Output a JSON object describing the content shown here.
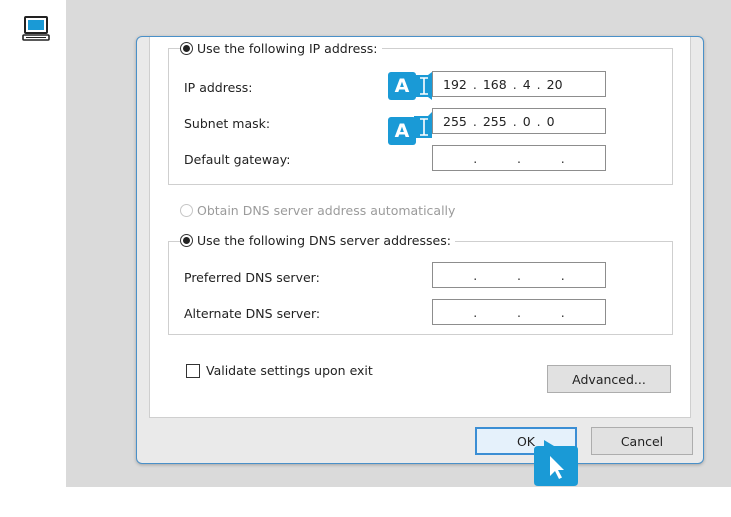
{
  "side_icon": "computer-icon",
  "ip_group": {
    "radio_label": "Use the following IP address:",
    "selected": true,
    "ip_address": {
      "label": "IP address:",
      "octets": [
        "192",
        "168",
        "4",
        "20"
      ]
    },
    "subnet_mask": {
      "label": "Subnet mask:",
      "octets": [
        "255",
        "255",
        "0",
        "0"
      ]
    },
    "default_gateway": {
      "label": "Default gateway:",
      "octets": [
        "",
        "",
        "",
        ""
      ]
    }
  },
  "dns_group": {
    "auto_label": "Obtain DNS server address automatically",
    "auto_disabled": true,
    "manual_label": "Use the following DNS server addresses:",
    "manual_selected": true,
    "preferred": {
      "label": "Preferred DNS server:",
      "octets": [
        "",
        "",
        "",
        ""
      ]
    },
    "alternate": {
      "label": "Alternate DNS server:",
      "octets": [
        "",
        "",
        "",
        ""
      ]
    }
  },
  "validate": {
    "label": "Validate settings upon exit",
    "checked": false
  },
  "buttons": {
    "advanced": "Advanced...",
    "ok": "OK",
    "cancel": "Cancel"
  },
  "badges": {
    "ip_badge": "A",
    "mask_badge": "A"
  },
  "colors": {
    "accent": "#1a9ad6",
    "dialog_border": "#4a90c8",
    "panel_bg": "#dadada"
  }
}
